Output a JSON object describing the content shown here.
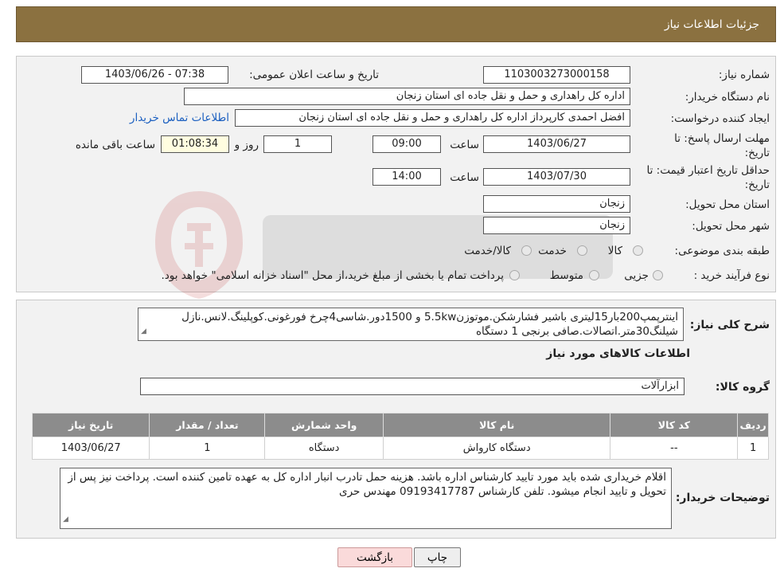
{
  "header": {
    "title": "جزئیات اطلاعات نیاز"
  },
  "form": {
    "need_number_label": "شماره نیاز:",
    "need_number": "1103003273000158",
    "announce_label": "تاریخ و ساعت اعلان عمومی:",
    "announce_value": "1403/06/26 - 07:38",
    "buyer_org_label": "نام دستگاه خریدار:",
    "buyer_org": "اداره کل راهداری و حمل و نقل جاده ای استان زنجان",
    "creator_label": "ایجاد کننده درخواست:",
    "creator": "افضل احمدی کارپرداز اداره کل راهداری و حمل و نقل جاده ای استان زنجان",
    "contact_link": "اطلاعات تماس خریدار",
    "deadline_label_1": "مهلت ارسال پاسخ: تا",
    "deadline_label_2": "تاریخ:",
    "deadline_date": "1403/06/27",
    "time_label": "ساعت",
    "deadline_time": "09:00",
    "days_value": "1",
    "days_label": "روز و",
    "remaining_time": "01:08:34",
    "remaining_label": "ساعت باقی مانده",
    "validity_label_1": "حداقل تاریخ اعتبار قیمت: تا",
    "validity_label_2": "تاریخ:",
    "validity_date": "1403/07/30",
    "validity_time": "14:00",
    "province_label": "استان محل تحویل:",
    "province": "زنجان",
    "city_label": "شهر محل تحویل:",
    "city": "زنجان",
    "category_label": "طبقه بندی موضوعی:",
    "category_options": [
      "کالا",
      "خدمت",
      "کالا/خدمت"
    ],
    "process_label": "نوع فرآیند خرید :",
    "process_options": [
      "جزیی",
      "متوسط"
    ],
    "process_note": "پرداخت تمام یا بخشی از مبلغ خرید،از محل \"اسناد خزانه اسلامی\" خواهد بود."
  },
  "details": {
    "summary_label": "شرح کلی نیاز:",
    "summary_text": "اینترپمپ200بار15لیتری باشیر فشارشکن.موتوزن5.5kw و 1500دور.شاسی4چرخ فورغونی.کوپلینگ.لانس.نازل شیلنگ30متر.اتصالات.صافی برنجی  1 دستگاه",
    "goods_info_title": "اطلاعات کالاهای مورد نیاز",
    "goods_group_label": "گروه کالا:",
    "goods_group": "ابزارآلات",
    "table": {
      "headers": [
        "ردیف",
        "کد کالا",
        "نام کالا",
        "واحد شمارش",
        "تعداد / مقدار",
        "تاریخ نیاز"
      ],
      "rows": [
        [
          "1",
          "--",
          "دستگاه کارواش",
          "دستگاه",
          "1",
          "1403/06/27"
        ]
      ]
    },
    "buyer_notes_label": "توضیحات خریدار:",
    "buyer_notes": "اقلام خریداری شده باید مورد تایید کارشناس اداره باشد. هزینه حمل تادرب انبار اداره کل به عهده تامین کننده است. پرداخت نیز پس از تحویل و تایید انجام میشود. تلفن کارشناس 09193417787 مهندس حری"
  },
  "buttons": {
    "print": "چاپ",
    "back": "بازگشت"
  },
  "colors": {
    "header": "#8b7140",
    "panel": "#f2f2f2",
    "table_header": "#8c8c8c",
    "link": "#1b5fc0"
  }
}
